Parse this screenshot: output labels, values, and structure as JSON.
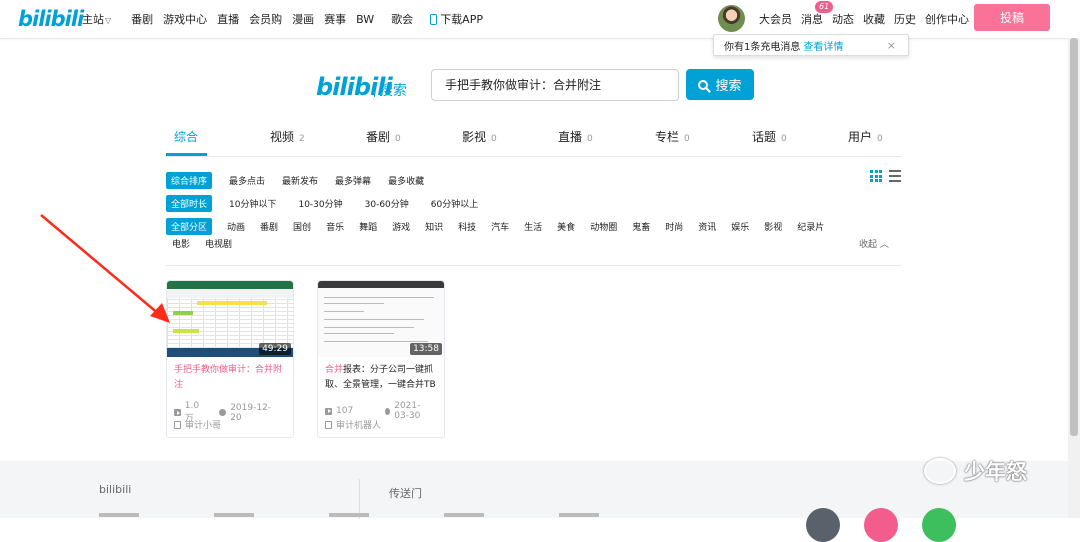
{
  "logo_text": "bilibili",
  "nav": {
    "items": [
      "主站",
      "番剧",
      "游戏中心",
      "直播",
      "会员购",
      "漫画",
      "赛事",
      "BW",
      "歌会"
    ],
    "download": "下载APP"
  },
  "right_nav": {
    "items": [
      "大会员",
      "消息",
      "动态",
      "收藏",
      "历史",
      "创作中心"
    ],
    "msg_badge": "61",
    "upload": "投稿"
  },
  "tooltip": {
    "text": "你有1条充电消息",
    "link": "查看详情",
    "close": "×"
  },
  "search": {
    "label": "搜索",
    "query": "手把手教你做审计：合并附注",
    "button": "搜索"
  },
  "tabs": [
    {
      "label": "综合",
      "count": ""
    },
    {
      "label": "视频",
      "count": "2"
    },
    {
      "label": "番剧",
      "count": "0"
    },
    {
      "label": "影视",
      "count": "0"
    },
    {
      "label": "直播",
      "count": "0"
    },
    {
      "label": "专栏",
      "count": "0"
    },
    {
      "label": "话题",
      "count": "0"
    },
    {
      "label": "用户",
      "count": "0"
    }
  ],
  "sort": [
    "综合排序",
    "最多点击",
    "最新发布",
    "最多弹幕",
    "最多收藏"
  ],
  "duration": [
    "全部时长",
    "10分钟以下",
    "10-30分钟",
    "30-60分钟",
    "60分钟以上"
  ],
  "zones": [
    "全部分区",
    "动画",
    "番剧",
    "国创",
    "音乐",
    "舞蹈",
    "游戏",
    "知识",
    "科技",
    "汽车",
    "生活",
    "美食",
    "动物圈",
    "鬼畜",
    "时尚",
    "资讯",
    "娱乐",
    "影视",
    "纪录片"
  ],
  "zones_row2": [
    "电影",
    "电视剧"
  ],
  "collapse": "收起 ︿",
  "videos": [
    {
      "duration": "49:29",
      "title_hl": "手把手教你做审计：合并附注",
      "title_rest": "",
      "plays": "1.0万",
      "date": "2019-12-20",
      "uploader": "审计小哥"
    },
    {
      "duration": "13:58",
      "title_hl": "合并",
      "title_rest": "报表：分子公司一键抓取、全景管理，一键合并TB",
      "plays": "107",
      "date": "2021-03-30",
      "uploader": "审计机器人"
    }
  ],
  "footer": {
    "col1": "bilibili",
    "col2": "传送门"
  },
  "watermark": "少年怒",
  "colors": {
    "brand": "#00a1d6",
    "pink": "#fb7299",
    "highlight": "#f25d8e",
    "annotation_arrow": "#ff2a1a"
  }
}
